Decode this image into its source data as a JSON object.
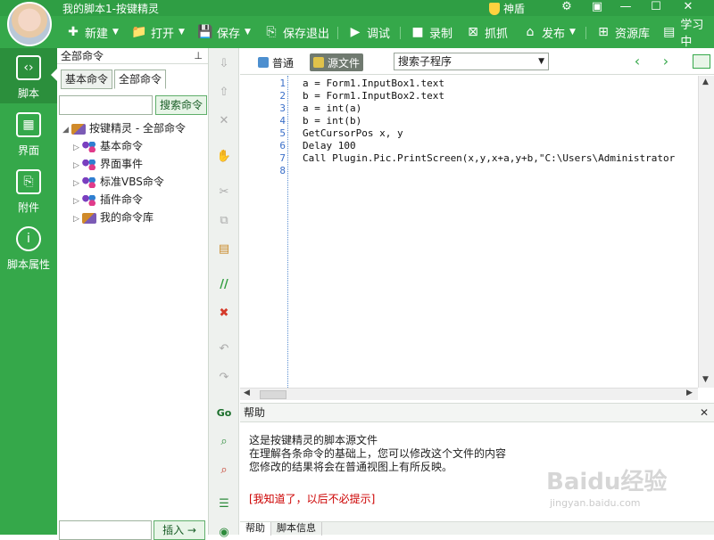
{
  "app": {
    "title": "我的脚本1-按键精灵",
    "shield_label": "神盾"
  },
  "toolbar": {
    "new": "新建",
    "open": "打开",
    "save": "保存",
    "save_exit": "保存退出",
    "debug": "调试",
    "record": "录制",
    "capture": "抓抓",
    "publish": "发布",
    "resource": "资源库",
    "learn": "学习中"
  },
  "leftnav": {
    "items": [
      {
        "label": "脚本",
        "icon": "script-icon"
      },
      {
        "label": "界面",
        "icon": "ui-grid-icon"
      },
      {
        "label": "附件",
        "icon": "attachment-icon"
      },
      {
        "label": "脚本属性",
        "icon": "info-icon"
      }
    ]
  },
  "cmdpanel": {
    "title": "全部命令",
    "tabs": [
      "基本命令",
      "全部命令"
    ],
    "search_button": "搜索命令",
    "search_value": "",
    "tree_root": "按键精灵 - 全部命令",
    "tree_children": [
      "基本命令",
      "界面事件",
      "标准VBS命令",
      "插件命令",
      "我的命令库"
    ],
    "insert_button": "插入 →"
  },
  "editor": {
    "tab_normal": "普通",
    "tab_source": "源文件",
    "proc_select": "搜索子程序",
    "lines": [
      "a = Form1.InputBox1.text",
      "b = Form1.InputBox2.text",
      "a = int(a)",
      "b = int(b)",
      "GetCursorPos x, y",
      "Delay 100",
      "Call Plugin.Pic.PrintScreen(x,y,x+a,y+b,\"C:\\Users\\Administrator",
      ""
    ],
    "line_numbers": [
      "1",
      "2",
      "3",
      "4",
      "5",
      "6",
      "7",
      "8"
    ]
  },
  "help": {
    "title": "帮助",
    "line1": "这是按键精灵的脚本源文件",
    "line2": "在理解各条命令的基础上，您可以修改这个文件的内容",
    "line3": "您修改的结果将会在普通视图上有所反映。",
    "dismiss": "[我知道了，以后不必提示]",
    "tabs": [
      "帮助",
      "脚本信息"
    ]
  },
  "watermark": {
    "brand": "Baidu经验",
    "url": "jingyan.baidu.com"
  },
  "colors": {
    "accent": "#35a84a",
    "accent_dark": "#2f9e44"
  }
}
